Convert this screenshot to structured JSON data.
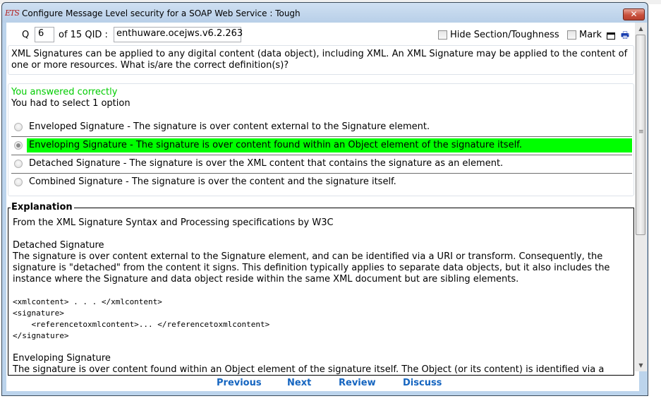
{
  "window": {
    "title": "Configure Message Level security for a SOAP Web Service : Tough",
    "app_icon": "ETS",
    "close_glyph": "✕"
  },
  "toolbar": {
    "q_label": "Q",
    "question_number": "6",
    "of_label": "of 15 QID :",
    "qid": "enthuware.ocejws.v6.2.263",
    "hide_section_label": "Hide Section/Toughness",
    "hide_section_checked": false,
    "mark_label": "Mark",
    "mark_checked": false
  },
  "question": {
    "text": "XML Signatures can be applied to any digital content (data object), including XML. An XML Signature may be applied to the content of one or more resources. What is/are the correct definition(s)?"
  },
  "answers": {
    "result": "You answered correctly",
    "instruction": "You had to select 1 option",
    "options": [
      {
        "text": "Enveloped Signature - The signature is over content external to the Signature element.",
        "selected": false,
        "correct": false
      },
      {
        "text": "Enveloping Signature - The signature is over content found within an Object element of the signature itself.",
        "selected": true,
        "correct": true
      },
      {
        "text": "Detached Signature - The signature is over the XML content that contains the signature as an element.",
        "selected": false,
        "correct": false
      },
      {
        "text": "Combined Signature - The signature is over the content and the signature itself.",
        "selected": false,
        "correct": false
      }
    ],
    "correct_color": "#00ff00",
    "result_color": "#00cc00"
  },
  "explanation": {
    "legend": "Explanation",
    "intro": "From the XML Signature Syntax and Processing specifications by W3C",
    "detached_title": "Detached Signature",
    "detached_text": "The signature is over content external to the Signature element, and can be identified via a URI or transform. Consequently, the signature is \"detached\" from the content it signs. This definition typically applies to separate data objects, but it also includes the instance where the Signature and data object reside within the same XML document but are sibling elements.",
    "code_lines": [
      "<xmlcontent> . . . </xmlcontent>",
      "<signature>",
      "    <referencetoxmlcontent>... </referencetoxmlcontent>",
      "</signature>"
    ],
    "enveloping_title": "Enveloping Signature",
    "enveloping_text": "The signature is over content found within an Object element of the signature itself. The Object (or its content) is identified via a"
  },
  "nav": {
    "previous": "Previous",
    "next": "Next",
    "review": "Review",
    "discuss": "Discuss"
  },
  "scrollbar": {
    "up_glyph": "▲",
    "down_glyph": "▼",
    "grip_glyph": "≡"
  }
}
